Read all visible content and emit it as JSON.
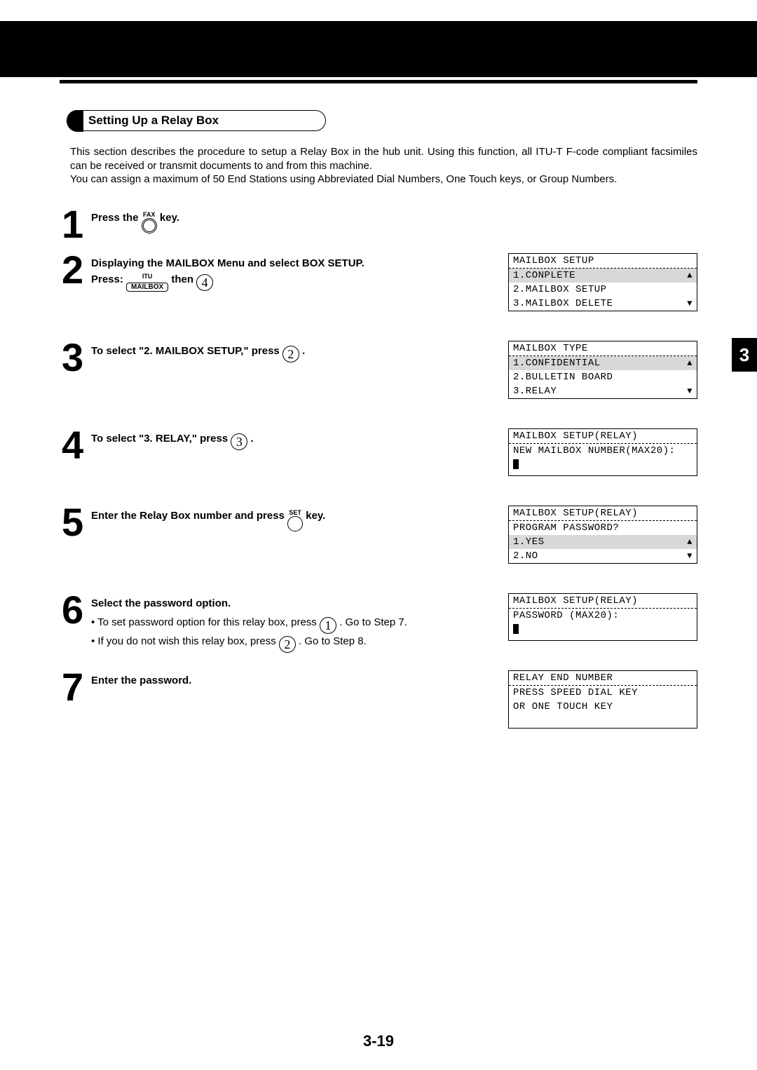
{
  "header": {
    "title": "Setting Up a Relay Box"
  },
  "intro": "This section describes the procedure to setup a Relay Box in the hub unit. Using this function, all ITU-T F-code compliant facsimiles can be received or transmit documents to and from this machine.\nYou can assign a maximum of 50 End Stations using Abbreviated Dial Numbers, One Touch keys, or Group Numbers.",
  "side_tab": "3",
  "page_number": "3-19",
  "steps": [
    {
      "num": "1",
      "title_parts": [
        "Press the ",
        " key."
      ],
      "key_label": {
        "top": "FAX"
      }
    },
    {
      "num": "2",
      "title": "Displaying the MAILBOX Menu and select BOX SETUP.",
      "sub_parts": [
        "Press: ",
        " then "
      ],
      "key_label": {
        "top": "ITU",
        "bottom": "MAILBOX"
      },
      "circle_num": "4",
      "lcd": {
        "head": "MAILBOX SETUP",
        "rows": [
          {
            "t": "1.CONPLETE",
            "shade": true,
            "up": true
          },
          {
            "t": "2.MAILBOX SETUP"
          },
          {
            "t": "3.MAILBOX DELETE",
            "down": true
          }
        ]
      }
    },
    {
      "num": "3",
      "title_parts": [
        "To select \"2. MAILBOX SETUP,\" press ",
        " ."
      ],
      "circle_num": "2",
      "lcd": {
        "head": "MAILBOX TYPE",
        "rows": [
          {
            "t": "1.CONFIDENTIAL",
            "shade": true,
            "up": true
          },
          {
            "t": "2.BULLETIN BOARD"
          },
          {
            "t": "3.RELAY",
            "down": true
          }
        ]
      }
    },
    {
      "num": "4",
      "title_parts": [
        "To select \"3. RELAY,\" press ",
        " ."
      ],
      "circle_num": "3",
      "lcd": {
        "head": "MAILBOX SETUP(RELAY)",
        "body": [
          "NEW MAILBOX NUMBER(MAX20):"
        ],
        "cursor": true
      }
    },
    {
      "num": "5",
      "title_parts": [
        "Enter the Relay Box number and press ",
        " key."
      ],
      "key_label": {
        "top": "SET"
      },
      "lcd": {
        "head": "MAILBOX SETUP(RELAY)",
        "rows": [
          {
            "t": "PROGRAM PASSWORD?"
          },
          {
            "t": "1.YES",
            "shade": true,
            "up": true
          },
          {
            "t": "2.NO",
            "down": true
          }
        ]
      }
    },
    {
      "num": "6",
      "title": "Select the password option.",
      "bullets": [
        {
          "pre": "To set password option for this relay box, press ",
          "n": "1",
          "post": " . Go to Step 7."
        },
        {
          "pre": "If you do not wish this relay box, press ",
          "n": "2",
          "post": " . Go to Step 8."
        }
      ],
      "lcd": {
        "head": "MAILBOX SETUP(RELAY)",
        "body": [
          "PASSWORD (MAX20):"
        ],
        "cursor": true
      }
    },
    {
      "num": "7",
      "title": "Enter the password.",
      "lcd": {
        "head": "RELAY END NUMBER",
        "body": [
          "PRESS SPEED DIAL KEY",
          "OR ONE TOUCH KEY",
          ""
        ]
      }
    }
  ]
}
